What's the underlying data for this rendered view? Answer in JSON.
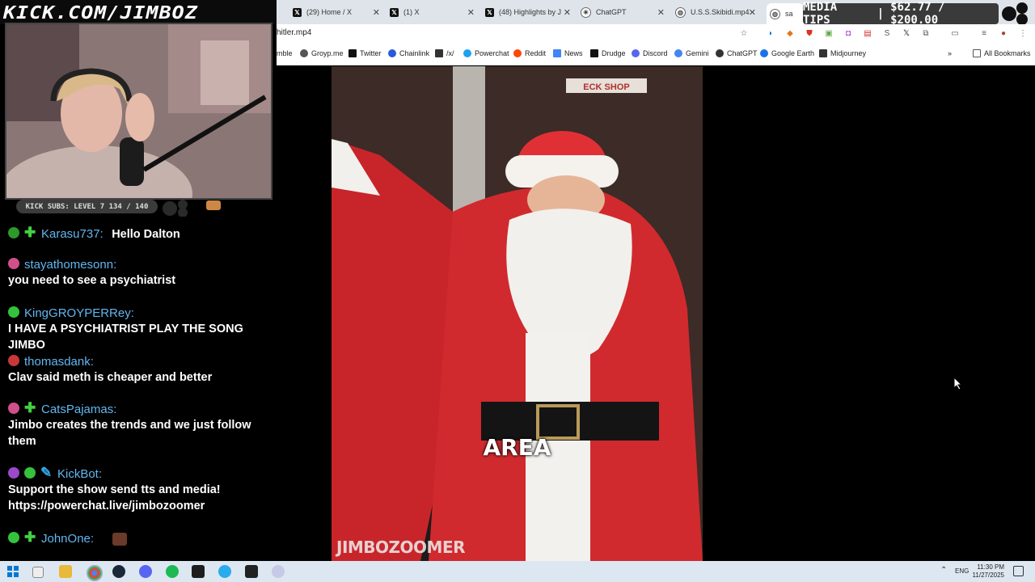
{
  "banner": {
    "text": "KICK.COM/JIMBOZ"
  },
  "tabs": [
    {
      "label": "(29) Home / X",
      "icon": "x-icon"
    },
    {
      "label": "(1) X",
      "icon": "x-icon"
    },
    {
      "label": "(48) Highlights by J",
      "icon": "x-icon"
    },
    {
      "label": "ChatGPT",
      "icon": "chatgpt-icon"
    },
    {
      "label": "U.S.S.Skibidi.mp4",
      "icon": "globe-icon"
    },
    {
      "label": "sa",
      "icon": "globe-icon"
    }
  ],
  "address": {
    "url": "hitler.mp4"
  },
  "bookmarks": [
    {
      "label": "mble",
      "color": "#3cb34a"
    },
    {
      "label": "Groyp.me",
      "color": "#555"
    },
    {
      "label": "Twitter",
      "color": "#111"
    },
    {
      "label": "Chainlink",
      "color": "#2a5ada"
    },
    {
      "label": "/x/",
      "color": "#333"
    },
    {
      "label": "Powerchat",
      "color": "#1da1f2"
    },
    {
      "label": "Reddit",
      "color": "#ff4500"
    },
    {
      "label": "News",
      "color": "#4285f4"
    },
    {
      "label": "Drudge",
      "color": "#111"
    },
    {
      "label": "Discord",
      "color": "#5865f2"
    },
    {
      "label": "Gemini",
      "color": "#4285f4"
    },
    {
      "label": "ChatGPT",
      "color": "#333"
    },
    {
      "label": "Google Earth",
      "color": "#1a73e8"
    },
    {
      "label": "Midjourney",
      "color": "#333"
    }
  ],
  "all_bookmarks": "All Bookmarks",
  "media_tips": {
    "label": "MEDIA TIPS",
    "value": "$62.77 / $200.00"
  },
  "subs": {
    "text": "KICK SUBS: LEVEL 7 134 / 140"
  },
  "chat": [
    {
      "user": "Karasu737:",
      "text": "Hello Dalton",
      "badges": [
        "green",
        "plus"
      ]
    },
    {
      "user": "stayathomesonn:",
      "text": "you need to see a psychiatrist",
      "badges": [
        "pink"
      ]
    },
    {
      "user": "KingGROYPERRey:",
      "text": "I HAVE A PSYCHIATRIST PLAY THE SONG JIMBO",
      "badges": [
        "greenx"
      ]
    },
    {
      "user": "thomasdank:",
      "text": "Clav said meth is cheaper and better",
      "badges": [
        "red"
      ]
    },
    {
      "user": "CatsPajamas:",
      "text": "Jimbo creates the trends and we just follow them",
      "badges": [
        "pink",
        "plus"
      ]
    },
    {
      "user": "KickBot:",
      "text": "Support the show send tts and media! https://powerchat.live/jimbozoomer",
      "badges": [
        "purple",
        "check",
        "wrench"
      ]
    },
    {
      "user": "JohnOne:",
      "text": "",
      "badges": [
        "greenx",
        "plus"
      ]
    }
  ],
  "video": {
    "caption": "AREA",
    "watermark": "JIMBOZOOMER",
    "shop_sign": "ECK SHOP"
  },
  "taskbar": {
    "lang": "ENG",
    "time": "11:30 PM",
    "date": "11/27/2025"
  }
}
